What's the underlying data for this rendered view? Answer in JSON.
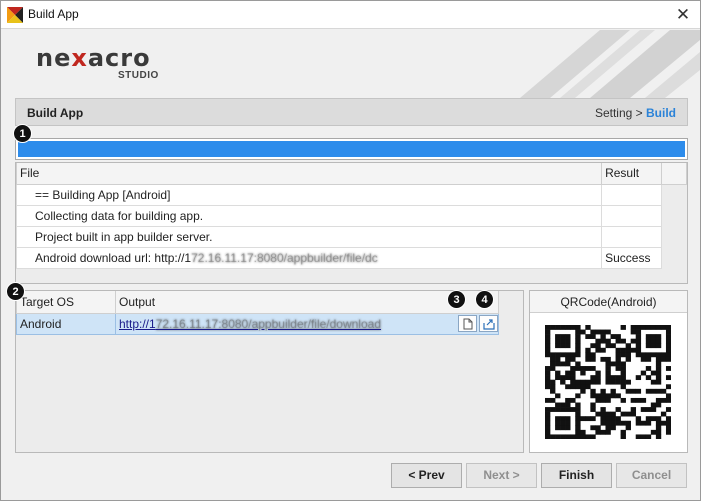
{
  "window": {
    "title": "Build App",
    "close_glyph": "✕"
  },
  "banner": {
    "logo_prefix": "ne",
    "logo_x": "x",
    "logo_suffix": "acro",
    "logo_sub": "STUDIO"
  },
  "header": {
    "title": "Build App",
    "breadcrumb": {
      "step1": "Setting",
      "separator": ">",
      "step2": "Build"
    }
  },
  "progress": {
    "value": 1.0,
    "color": "#2d8ceb"
  },
  "badges": [
    "1",
    "2",
    "3",
    "4"
  ],
  "log_table": {
    "columns": [
      "File",
      "Result"
    ],
    "rows": [
      {
        "file": "== Building App [Android]",
        "result": "",
        "blurred_suffix": ""
      },
      {
        "file": "Collecting data for building app.",
        "result": "",
        "blurred_suffix": ""
      },
      {
        "file": "Project built in app builder server.",
        "result": "",
        "blurred_suffix": ""
      },
      {
        "file": "Android download url: http://1",
        "result": "Success",
        "blurred_suffix": "72.16.11.17:8080/appbuilder/file/dc"
      }
    ]
  },
  "output_table": {
    "columns": [
      "Target OS",
      "Output"
    ],
    "rows": [
      {
        "os": "Android",
        "url": "http://1",
        "url_blurred": "72.16.11.17:8080/appbuilder/file/download"
      }
    ]
  },
  "icons": {
    "copy": "copy-icon",
    "open": "open-external-icon",
    "close": "close-icon"
  },
  "qr": {
    "title": "QRCode(Android)"
  },
  "buttons": {
    "prev": "< Prev",
    "next": "Next >",
    "finish": "Finish",
    "cancel": "Cancel"
  },
  "colors": {
    "accent": "#2b83d8",
    "selection": "#cfe4f7",
    "logo_red": "#c0271f"
  }
}
